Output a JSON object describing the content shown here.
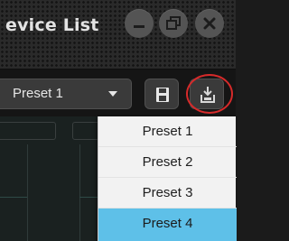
{
  "window": {
    "title": "evice List",
    "controls": {
      "minimize_icon": "minimize-icon",
      "restore_icon": "restore-icon",
      "close_icon": "close-icon"
    }
  },
  "toolbar": {
    "preset_select": {
      "value": "Preset 1"
    },
    "save_icon": "save-icon",
    "load_icon": "load-preset-icon",
    "highlight_color": "#d62a2a"
  },
  "dropdown": {
    "items": [
      "Preset 1",
      "Preset 2",
      "Preset 3",
      "Preset 4"
    ],
    "selected_index": 3,
    "selected_color": "#5ec0e8"
  }
}
